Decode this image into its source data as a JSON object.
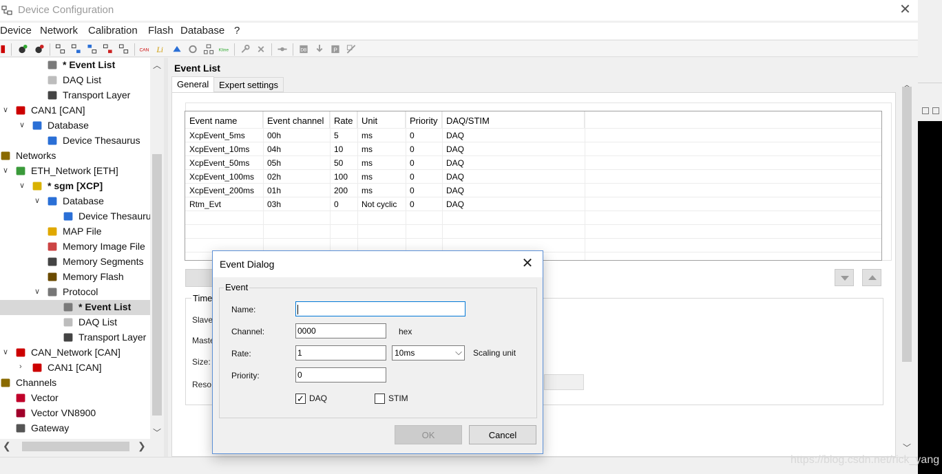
{
  "window": {
    "title": "Device Configuration",
    "close_glyph": "✕"
  },
  "menu": [
    "Device",
    "Network",
    "Calibration",
    "Flash",
    "Database",
    "?"
  ],
  "tree": {
    "items": [
      {
        "label": "* Event List",
        "bold": true,
        "icon": "gear-icon"
      },
      {
        "label": "DAQ List",
        "icon": "list-icon"
      },
      {
        "label": "Transport Layer",
        "icon": "network-icon"
      },
      {
        "label": "CAN1 [CAN]",
        "icon": "can-icon"
      },
      {
        "label": "Database",
        "icon": "database-icon"
      },
      {
        "label": "Device Thesaurus",
        "icon": "thesaurus-icon"
      },
      {
        "label": "Networks",
        "icon": "networks-icon"
      },
      {
        "label": "ETH_Network [ETH]",
        "icon": "eth-icon"
      },
      {
        "label": "* sgm [XCP]",
        "bold": true,
        "icon": "xcp-device-icon"
      },
      {
        "label": "Database",
        "icon": "database-icon"
      },
      {
        "label": "Device Thesaurus",
        "icon": "thesaurus-icon"
      },
      {
        "label": "MAP File",
        "icon": "map-file-icon"
      },
      {
        "label": "Memory Image File",
        "icon": "memory-image-icon"
      },
      {
        "label": "Memory Segments",
        "icon": "memory-segments-icon"
      },
      {
        "label": "Memory Flash",
        "icon": "memory-flash-icon"
      },
      {
        "label": "Protocol",
        "icon": "protocol-icon"
      },
      {
        "label": "* Event List",
        "bold": true,
        "selected": true,
        "icon": "gear-icon"
      },
      {
        "label": "DAQ List",
        "icon": "list-icon"
      },
      {
        "label": "Transport Layer",
        "icon": "network-icon"
      },
      {
        "label": "CAN_Network [CAN]",
        "icon": "can-network-icon"
      },
      {
        "label": "CAN1 [CAN]",
        "icon": "can-icon"
      },
      {
        "label": "Channels",
        "icon": "channels-icon"
      },
      {
        "label": "Vector",
        "icon": "vector-icon"
      },
      {
        "label": "Vector VN8900",
        "icon": "vn8900-icon"
      },
      {
        "label": "Gateway",
        "icon": "gateway-icon"
      }
    ]
  },
  "content": {
    "heading": "Event List",
    "tabs": [
      "General",
      "Expert settings"
    ],
    "table": {
      "columns": [
        "Event name",
        "Event channel",
        "Rate",
        "Unit",
        "Priority",
        "DAQ/STIM"
      ],
      "rows": [
        [
          "XcpEvent_5ms",
          "00h",
          "5",
          "ms",
          "0",
          "DAQ"
        ],
        [
          "XcpEvent_10ms",
          "04h",
          "10",
          "ms",
          "0",
          "DAQ"
        ],
        [
          "XcpEvent_50ms",
          "05h",
          "50",
          "ms",
          "0",
          "DAQ"
        ],
        [
          "XcpEvent_100ms",
          "02h",
          "100",
          "ms",
          "0",
          "DAQ"
        ],
        [
          "XcpEvent_200ms",
          "01h",
          "200",
          "ms",
          "0",
          "DAQ"
        ],
        [
          "Rtm_Evt",
          "03h",
          "0",
          "Not cyclic",
          "0",
          "DAQ"
        ]
      ]
    },
    "timing": {
      "legend": "Time",
      "labels": [
        "Slave",
        "Maste",
        "Size:",
        "Reso"
      ]
    }
  },
  "dialog": {
    "title": "Event Dialog",
    "group": "Event",
    "name_label": "Name:",
    "name_value": "",
    "channel_label": "Channel:",
    "channel_value": "0000",
    "channel_unit": "hex",
    "rate_label": "Rate:",
    "rate_value": "1",
    "rate_unit_selected": "10ms",
    "scaling_unit_label": "Scaling unit",
    "priority_label": "Priority:",
    "priority_value": "0",
    "daq_label": "DAQ",
    "daq_checked": true,
    "stim_label": "STIM",
    "stim_checked": false,
    "ok_label": "OK",
    "cancel_label": "Cancel"
  },
  "watermark": "https://blog.csdn.net/rick_yang",
  "colors": {
    "selection": "#d8d8d8",
    "focus": "#0078d7",
    "dialog_border": "#5b8fd6"
  }
}
